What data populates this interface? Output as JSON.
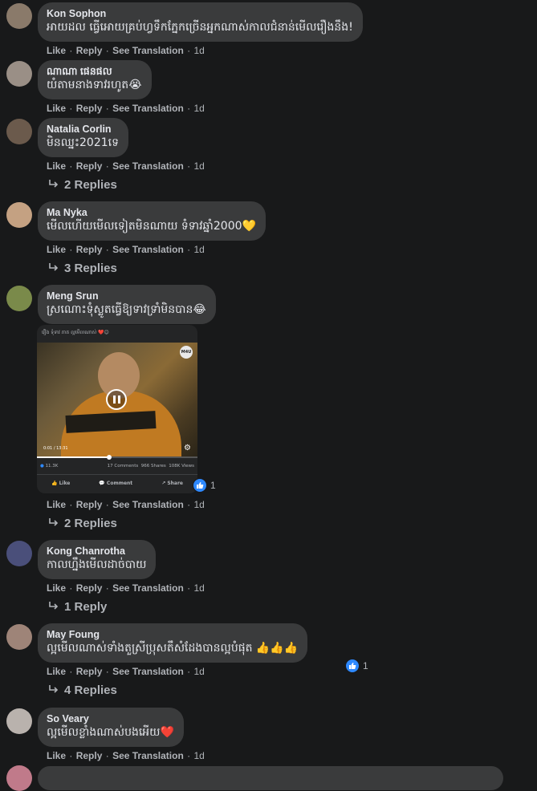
{
  "actions": {
    "like": "Like",
    "reply": "Reply",
    "see_translation": "See Translation",
    "separator": "·"
  },
  "colors": {
    "background": "#18191a",
    "bubble": "#3a3b3c",
    "like_blue": "#2e89ff",
    "heart_red": "#e41e3f"
  },
  "comments": [
    {
      "author": "Kon Sophon",
      "text": "អាយដល ធ្វើអោយគ្រប់ហ្វទឹកភ្នែកច្រើនអ្នកណាស់កាលជំនាន់មើលរឿងនឹង!",
      "time": "1d",
      "avatar_color": "#8a7a6a"
    },
    {
      "author": "ណាណា ផេនផល",
      "text": "យំតាមនាងទាវរហូត😭",
      "time": "1d",
      "avatar_color": "#9a8f86"
    },
    {
      "author": "Natalia Corlin",
      "text": "មិនឈ្នះ2021ទេ",
      "time": "1d",
      "avatar_color": "#6b5a4c",
      "replies": "2 Replies"
    },
    {
      "author": "Ma Nyka",
      "text": "មើលហើយមើលទៀតមិនណាយ ទំទាវឆ្នាំ2000💛",
      "time": "1d",
      "avatar_color": "#c4a182",
      "replies": "3 Replies"
    },
    {
      "author": "Meng Srun",
      "text": "ស្រណោះទុំស្លូតធ្វើឱ្យទាវទ្រាំមិនបាន😂",
      "time": "1d",
      "avatar_color": "#7a8a4a",
      "replies": "2 Replies",
      "reaction_count": "1",
      "media": {
        "caption": "រឿង ទុំទាវ ភាគ ល្អមើលណាស់ ❤️😊",
        "badge": "M4U",
        "time": "0:01 / 13:31",
        "progress": 0.45,
        "reactions": "11.3K",
        "comments": "17 Comments",
        "shares": "966 Shares",
        "views": "108K Views",
        "like": "Like",
        "comment": "Comment",
        "share": "Share"
      }
    },
    {
      "author": "Kong Chanrotha",
      "text": "កាលហ្នឹងមើលដាច់បាយ",
      "time": "1d",
      "avatar_color": "#4a4f7a",
      "replies": "1 Reply"
    },
    {
      "author": "May Foung",
      "text": "ល្អមើលណាស់ទាំងតួស្រីប្រុសតឹសំដែងបានល្អបំផុត 👍👍👍",
      "time": "1d",
      "avatar_color": "#9e8478",
      "replies": "4 Replies",
      "reaction_count": "1"
    },
    {
      "author": "So Veary",
      "text": "ល្អមើលខ្លាំងណាស់បងអើយ❤️",
      "time": "1d",
      "avatar_color": "#b9b2ad"
    }
  ]
}
